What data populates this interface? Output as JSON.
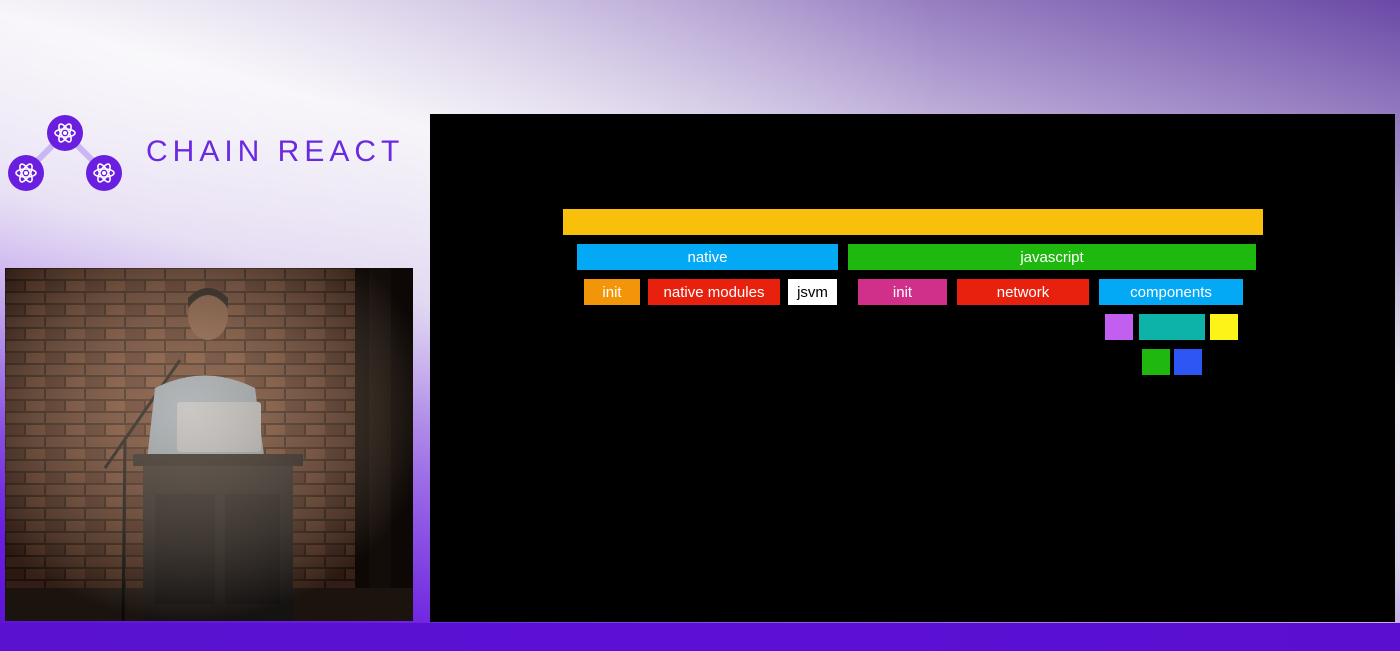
{
  "brand": {
    "name": "CHAIN REACT",
    "logo_icon": "react-atom-triangle-logo",
    "color": "#6a2be0"
  },
  "video": {
    "description_icon": "speaker-at-podium-video-feed"
  },
  "slide": {
    "background": "#000000",
    "top_bar": {
      "label": "",
      "color": "#f9c00b"
    },
    "level1": [
      {
        "label": "native",
        "color": "#03a9f4"
      },
      {
        "label": "javascript",
        "color": "#1fb80f"
      }
    ],
    "level2": [
      {
        "label": "init",
        "color": "#f39508"
      },
      {
        "label": "native modules",
        "color": "#e8210f"
      },
      {
        "label": "jsvm",
        "color": "#ffffff",
        "text_color": "#000000"
      },
      {
        "label": "init",
        "color": "#d1308a"
      },
      {
        "label": "network",
        "color": "#e8210f"
      },
      {
        "label": "components",
        "color": "#03a9f4"
      }
    ],
    "level3": [
      {
        "label": "",
        "color": "#c25ff0"
      },
      {
        "label": "",
        "color": "#0cb3a6"
      },
      {
        "label": "",
        "color": "#fcf319"
      }
    ],
    "level4": [
      {
        "label": "",
        "color": "#1fb80f"
      },
      {
        "label": "",
        "color": "#2e56f5"
      }
    ]
  }
}
